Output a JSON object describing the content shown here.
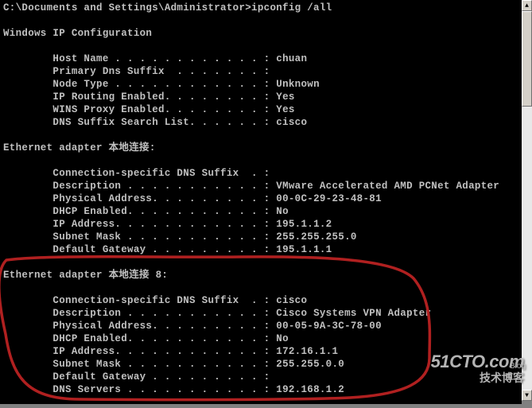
{
  "prompt": "C:\\Documents and Settings\\Administrator>ipconfig /all",
  "ipcfg_header": "Windows IP Configuration",
  "g": {
    "host": {
      "k": "        Host Name . . . . . . . . . . . . : ",
      "v": "chuan"
    },
    "psfx": {
      "k": "        Primary Dns Suffix  . . . . . . . :",
      "v": ""
    },
    "ntype": {
      "k": "        Node Type . . . . . . . . . . . . : ",
      "v": "Unknown"
    },
    "iprt": {
      "k": "        IP Routing Enabled. . . . . . . . : ",
      "v": "Yes"
    },
    "wins": {
      "k": "        WINS Proxy Enabled. . . . . . . . : ",
      "v": "Yes"
    },
    "dns_sl": {
      "k": "        DNS Suffix Search List. . . . . . : ",
      "v": "cisco"
    }
  },
  "ad1": {
    "title_en": "Ethernet adapter ",
    "title_cn": "本地连接",
    "title_suffix": ":",
    "csfx": {
      "k": "        Connection-specific DNS Suffix  . :",
      "v": ""
    },
    "desc": {
      "k": "        Description . . . . . . . . . . . : ",
      "v": "VMware Accelerated AMD PCNet Adapter"
    },
    "phy": {
      "k": "        Physical Address. . . . . . . . . : ",
      "v": "00-0C-29-23-48-81"
    },
    "dhcp": {
      "k": "        DHCP Enabled. . . . . . . . . . . : ",
      "v": "No"
    },
    "ip": {
      "k": "        IP Address. . . . . . . . . . . . : ",
      "v": "195.1.1.2"
    },
    "mask": {
      "k": "        Subnet Mask . . . . . . . . . . . : ",
      "v": "255.255.255.0"
    },
    "gw": {
      "k": "        Default Gateway . . . . . . . . . : ",
      "v": "195.1.1.1"
    }
  },
  "ad2": {
    "title_en": "Ethernet adapter ",
    "title_cn": "本地连接",
    "title_suffix": " 8:",
    "csfx": {
      "k": "        Connection-specific DNS Suffix  . : ",
      "v": "cisco"
    },
    "desc": {
      "k": "        Description . . . . . . . . . . . : ",
      "v": "Cisco Systems VPN Adapter"
    },
    "phy": {
      "k": "        Physical Address. . . . . . . . . : ",
      "v": "00-05-9A-3C-78-00"
    },
    "dhcp": {
      "k": "        DHCP Enabled. . . . . . . . . . . : ",
      "v": "No"
    },
    "ip": {
      "k": "        IP Address. . . . . . . . . . . . : ",
      "v": "172.16.1.1"
    },
    "mask": {
      "k": "        Subnet Mask . . . . . . . . . . . : ",
      "v": "255.255.0.0"
    },
    "gw": {
      "k": "        Default Gateway . . . . . . . . . :",
      "v": ""
    },
    "dns": {
      "k": "        DNS Servers . . . . . . . . . . . : ",
      "v": "192.168.1.2"
    }
  },
  "watermark": {
    "l1": "51CTO.com",
    "l2": "技术博客",
    "l3": "Blog"
  }
}
